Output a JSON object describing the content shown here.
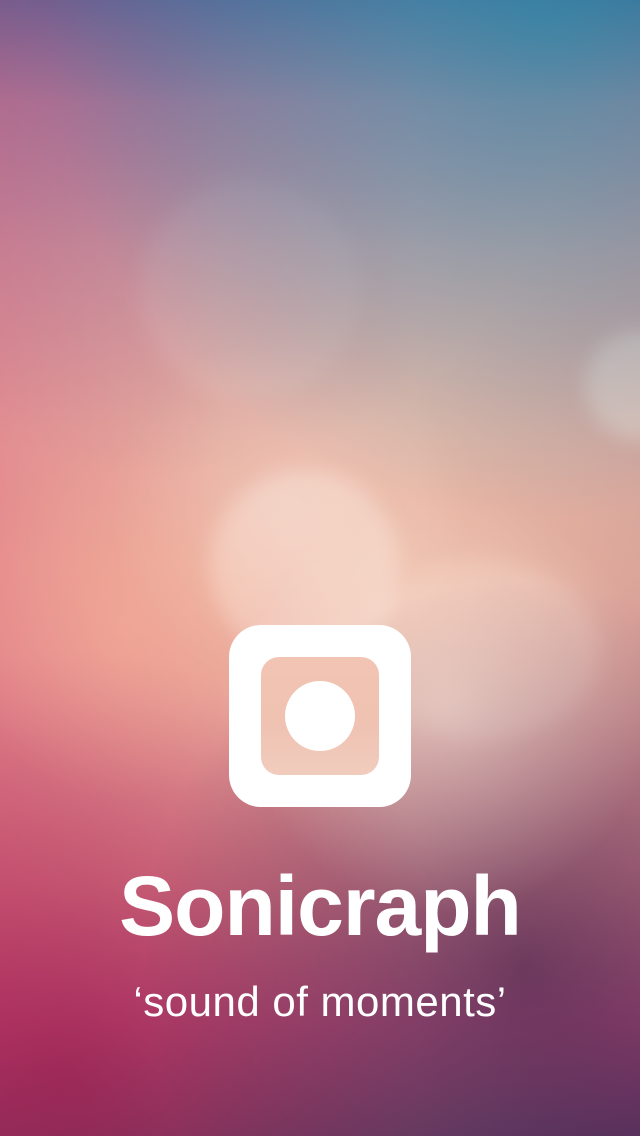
{
  "app": {
    "name": "Sonicraph",
    "tagline": "‘sound of moments’"
  },
  "icons": {
    "logo": "camera-record-icon"
  },
  "colors": {
    "text": "#ffffff",
    "logo_bg": "#ffffff",
    "logo_window": "#f0c3b2"
  }
}
